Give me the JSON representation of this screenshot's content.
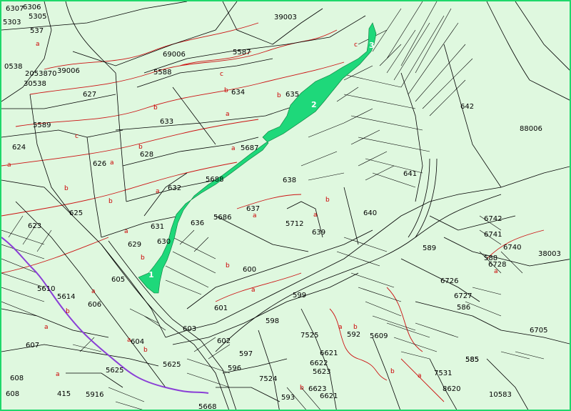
{
  "map": {
    "colors": {
      "background": "#dff8df",
      "frame": "#1ed86a",
      "parcel_lines": "#000000",
      "contour_lines": "#cc1111",
      "highlight_fill": "#1ed87a",
      "boundary_line": "#8a3fd6",
      "badge_text": "#ffffff"
    },
    "highlight_labels": [
      "1",
      "2",
      "3"
    ],
    "parcel_labels": [
      "6307",
      "6306",
      "5305",
      "5303",
      "537",
      "39003",
      "69006",
      "5587",
      "5588",
      "0538",
      "2053870",
      "39006",
      "30538",
      "627",
      "634",
      "635",
      "5589",
      "633",
      "642",
      "624",
      "626",
      "628",
      "5687",
      "88006",
      "632",
      "5688",
      "638",
      "641",
      "625",
      "637",
      "640",
      "5686",
      "623",
      "631",
      "630",
      "636",
      "5712",
      "639",
      "629",
      "589",
      "38003",
      "588",
      "600",
      "605",
      "5614",
      "599",
      "5610",
      "598",
      "601",
      "606",
      "603",
      "7525",
      "592",
      "602",
      "607",
      "5625",
      "597",
      "604",
      "7524",
      "608",
      "415",
      "596",
      "5916",
      "593",
      "5625",
      "5668",
      "585",
      "10583",
      "8620",
      "586",
      "6726",
      "6705",
      "6728",
      "6727",
      "6741",
      "6742",
      "6740",
      "585",
      "7531",
      "6621",
      "6622",
      "5623",
      "6621",
      "6623",
      "5609",
      "608"
    ],
    "subparcel_labels": [
      "a",
      "b",
      "c"
    ]
  }
}
